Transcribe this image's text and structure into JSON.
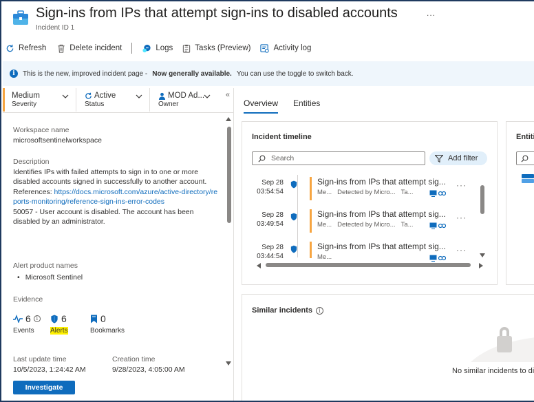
{
  "header": {
    "title": "Sign-ins from IPs that attempt sign-ins to disabled accounts",
    "subtitle": "Incident ID 1",
    "more": "..."
  },
  "toolbar": {
    "refresh": "Refresh",
    "delete": "Delete incident",
    "logs": "Logs",
    "tasks": "Tasks (Preview)",
    "activity": "Activity log"
  },
  "banner": {
    "text_pre": "This is the new, improved incident page -",
    "text_bold": "Now generally available.",
    "text_post": "You can use the toggle to switch back."
  },
  "properties": {
    "severity": {
      "value": "Medium",
      "label": "Severity"
    },
    "status": {
      "value": "Active",
      "label": "Status"
    },
    "owner": {
      "value": "MOD Ad...",
      "label": "Owner"
    }
  },
  "details": {
    "workspace_label": "Workspace name",
    "workspace_value": "microsoftsentinelworkspace",
    "description_label": "Description",
    "description_text": "Identifies IPs with failed attempts to sign in to one or more disabled accounts signed in successfully to another account.",
    "references_label": "References:",
    "references_link": "https://docs.microsoft.com/azure/active-directory/reports-monitoring/reference-sign-ins-error-codes",
    "error_text": "50057 - User account is disabled. The account has been disabled by an administrator.",
    "alert_product_label": "Alert product names",
    "alert_product_value": "Microsoft Sentinel",
    "evidence_label": "Evidence",
    "last_update_label": "Last update time",
    "last_update_value": "10/5/2023, 1:24:42 AM",
    "creation_label": "Creation time",
    "creation_value": "9/28/2023, 4:05:00 AM"
  },
  "evidence": {
    "events": {
      "count": "6",
      "label": "Events"
    },
    "alerts": {
      "count": "6",
      "label": "Alerts"
    },
    "bookmarks": {
      "count": "0",
      "label": "Bookmarks"
    }
  },
  "investigate_label": "Investigate",
  "tabs": {
    "overview": "Overview",
    "entities": "Entities"
  },
  "timeline": {
    "title": "Incident timeline",
    "search_placeholder": "Search",
    "add_filter": "Add filter",
    "items": [
      {
        "date": "Sep 28",
        "time": "03:54:54",
        "title": "Sign-ins from IPs that attempt sig...",
        "severity": "Me...",
        "detected": "Detected by Micro...",
        "tag": "Ta..."
      },
      {
        "date": "Sep 28",
        "time": "03:49:54",
        "title": "Sign-ins from IPs that attempt sig...",
        "severity": "Me...",
        "detected": "Detected by Micro...",
        "tag": "Ta..."
      },
      {
        "date": "Sep 28",
        "time": "03:44:54",
        "title": "Sign-ins from IPs that attempt sig...",
        "severity": "Me...",
        "detected": "",
        "tag": ""
      }
    ]
  },
  "entities_card": {
    "title": "Entiti"
  },
  "similar": {
    "title": "Similar incidents",
    "empty": "No similar incidents to di"
  },
  "colors": {
    "accent": "#0f6cbd",
    "severity_medium": "#f7a541",
    "highlight": "#fff100",
    "banner_bg": "#eff6fc"
  }
}
